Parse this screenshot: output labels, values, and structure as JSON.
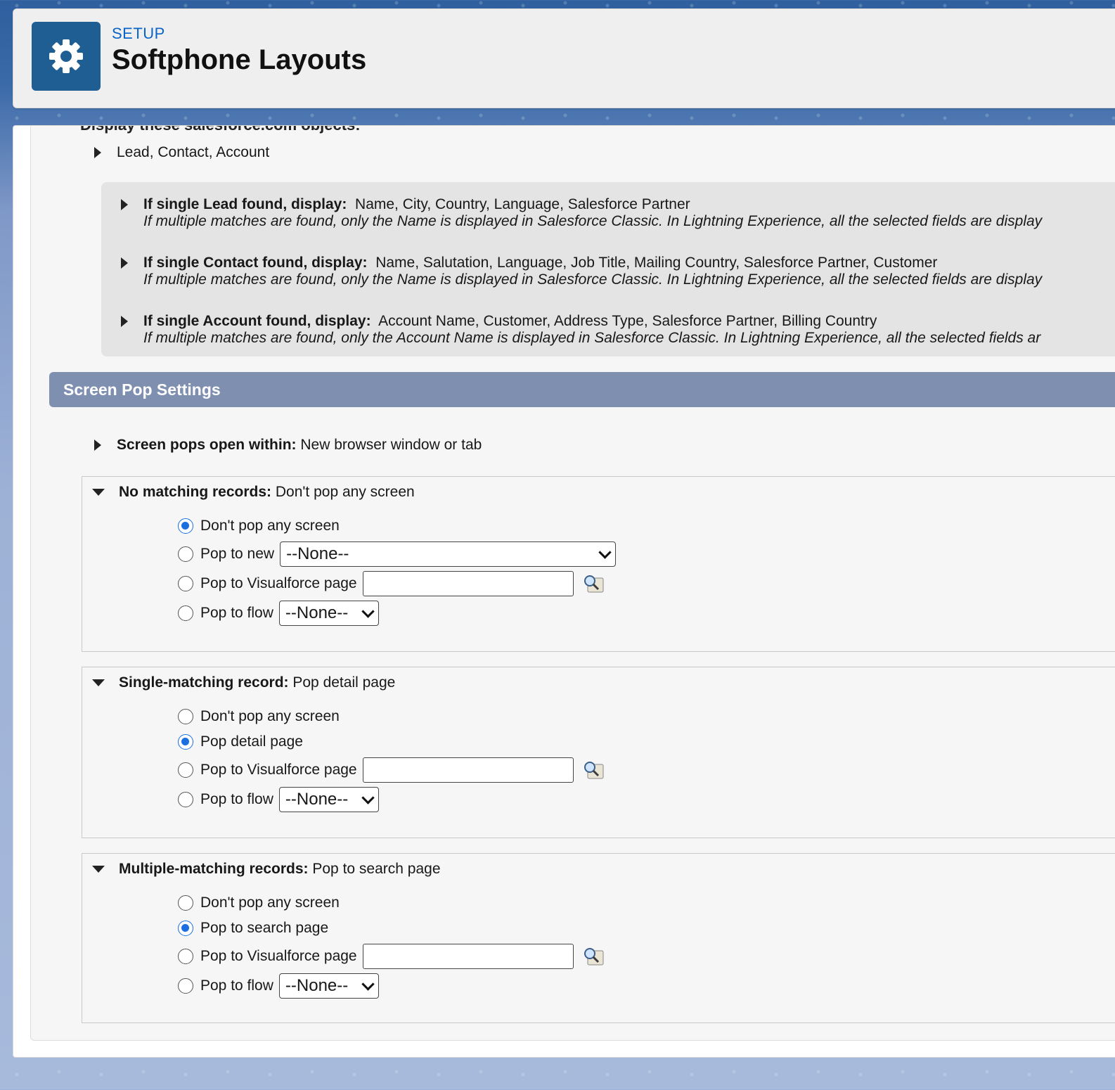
{
  "header": {
    "setup_label": "SETUP",
    "title": "Softphone Layouts"
  },
  "display_objects": {
    "cut_header": "Display these salesforce.com objects:",
    "objects_label": "Lead, Contact, Account"
  },
  "found_rows": [
    {
      "label": "If single Lead found, display:",
      "fields": "Name, City, Country, Language, Salesforce Partner",
      "note": "If multiple matches are found, only the Name is displayed in Salesforce Classic. In Lightning Experience, all the selected fields are display"
    },
    {
      "label": "If single Contact found, display:",
      "fields": "Name, Salutation, Language, Job Title, Mailing Country, Salesforce Partner, Customer",
      "note": "If multiple matches are found, only the Name is displayed in Salesforce Classic. In Lightning Experience, all the selected fields are display"
    },
    {
      "label": "If single Account found, display:",
      "fields": "Account Name, Customer, Address Type, Salesforce Partner, Billing Country",
      "note": "If multiple matches are found, only the Account Name is displayed in Salesforce Classic. In Lightning Experience, all the selected fields ar"
    }
  ],
  "screen_pop": {
    "section_title": "Screen Pop Settings",
    "open_within_label": "Screen pops open within:",
    "open_within_value": "New browser window or tab",
    "none_option": "--None--",
    "boxes": [
      {
        "label": "No matching records:",
        "value": "Don't pop any screen",
        "options": [
          "Don't pop any screen",
          "Pop to new",
          "Pop to Visualforce page",
          "Pop to flow"
        ]
      },
      {
        "label": "Single-matching record:",
        "value": "Pop detail page",
        "options": [
          "Don't pop any screen",
          "Pop detail page",
          "Pop to Visualforce page",
          "Pop to flow"
        ]
      },
      {
        "label": "Multiple-matching records:",
        "value": "Pop to search page",
        "options": [
          "Don't pop any screen",
          "Pop to search page",
          "Pop to Visualforce page",
          "Pop to flow"
        ]
      }
    ]
  },
  "colors": {
    "brand_blue": "#1f5e93",
    "section_bar": "#7f8fb0",
    "radio_selected": "#1a6fe0"
  }
}
